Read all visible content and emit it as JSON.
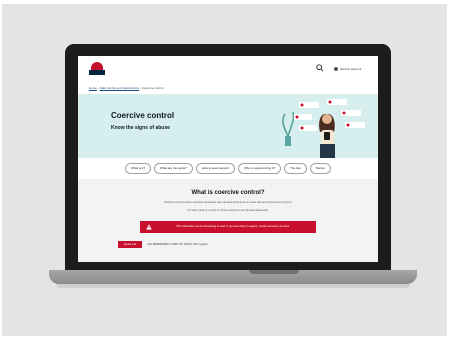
{
  "site": {
    "account_label": "Service account"
  },
  "breadcrumb": {
    "home": "Home",
    "parent": "Safer family and relationships",
    "current": "Coercive control"
  },
  "hero": {
    "title": "Coercive control",
    "subtitle": "Know the signs of abuse"
  },
  "tabs": [
    {
      "label": "What is it?"
    },
    {
      "label": "What are the signs?"
    },
    {
      "label": "How to seek support"
    },
    {
      "label": "Who is experiencing it?"
    },
    {
      "label": "The law"
    },
    {
      "label": "Stories"
    }
  ],
  "content": {
    "title": "What is coercive control?",
    "para1": "Coercive control is when someone repeatedly uses abusive behaviours to create fear and control over a person.",
    "para2": "It is often used by current or former partners in an intimate relationship.",
    "alert": "This information can be distressing to read. If you need help or support, contact someone you trust.",
    "help_button": "Quick exit",
    "help_text": "Call 1800RESPECT (1800 737 732) for 24/7 support"
  },
  "colors": {
    "brand_red": "#c8102e",
    "brand_navy": "#00263e",
    "hero_bg": "#d6eeee"
  }
}
